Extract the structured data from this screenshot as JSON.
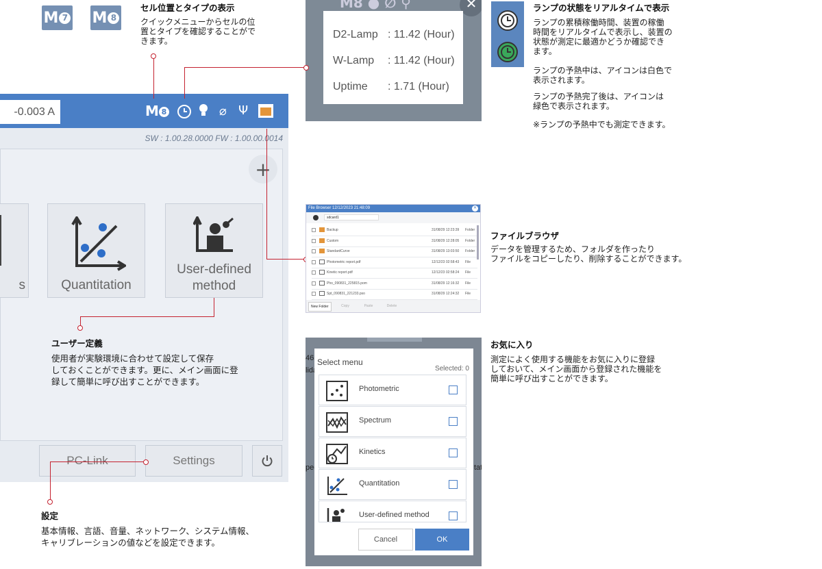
{
  "cell_section": {
    "badge7": "M7",
    "badge8": "M8",
    "title": "セル位置とタイプの表示",
    "desc": [
      "クイックメニューからセルの位",
      "置とタイプを確認することがで",
      "きます。"
    ]
  },
  "lamp_popup": {
    "rows": [
      {
        "label": "D2-Lamp",
        "value": ": 11.42 (Hour)"
      },
      {
        "label": "W-Lamp",
        "value": ": 11.42 (Hour)"
      },
      {
        "label": "Uptime",
        "value": ": 1.71 (Hour)"
      }
    ]
  },
  "lamp_section": {
    "title": "ランプの状態をリアルタイムで表示",
    "desc": [
      "ランプの累積稼働時間、装置の稼働",
      "時間をリアルタイムで表示し、装置の",
      "状態が測定に最適かどうか確認でき",
      "ます。"
    ],
    "desc2": [
      "ランプの予熱中は、アイコンは白色で",
      "表示されます。"
    ],
    "desc3": [
      "ランプの予熱完了後は、アイコンは",
      "緑色で表示されます。"
    ],
    "note": "※ランプの予熱中でも測定できます。",
    "icon_colors": {
      "warming": "#ffffff",
      "ready": "#3aa85a"
    }
  },
  "app": {
    "current_value": "-0.003 A",
    "version": "SW : 1.00.28.0000  FW : 1.00.00.0014",
    "tiles": [
      {
        "label": "s"
      },
      {
        "label": "Quantitation"
      },
      {
        "label": "User-defined method"
      }
    ],
    "buttons": {
      "pc_link": "PC-Link",
      "settings": "Settings"
    }
  },
  "user_section": {
    "title": "ユーザー定義",
    "desc": [
      "使用者が実験環境に合わせて設定して保存",
      "しておくことができます。更に、メイン画面に登",
      "録して簡単に呼び出すことができます。"
    ]
  },
  "settings_section": {
    "title": "設定",
    "desc": [
      "基本情報、言語、音量、ネットワーク、システム情報、",
      "キャリブレーションの値などを設定できます。"
    ]
  },
  "file_browser": {
    "title": "File Browser  12/12/2023 21:48:09",
    "path": "sdcard1",
    "rows": [
      {
        "name": "Backup",
        "date": "31/08/29  12:23:39",
        "type": "Folder"
      },
      {
        "name": "Custom",
        "date": "31/08/29  12:28:05",
        "type": "Folder"
      },
      {
        "name": "StandardCurve",
        "date": "31/08/29  13:03:50",
        "type": "Folder"
      },
      {
        "name": "Photometric report.pdf",
        "date": "12/12/23  02:58:43",
        "type": "File"
      },
      {
        "name": "Kinetic report.pdf",
        "date": "12/12/23  02:58:24",
        "type": "File"
      },
      {
        "name": "Pho_090831_225815.pom",
        "date": "31/08/29  12:16:32",
        "type": "File"
      },
      {
        "name": "Spt_090831_221233.pso",
        "date": "31/08/29  12:24:32",
        "type": "File"
      }
    ],
    "actions": [
      "New Folder",
      "Copy",
      "Paste",
      "Delete"
    ]
  },
  "file_section": {
    "title": "ファイルブラウザ",
    "desc": [
      "データを管理するため、フォルダを作ったり",
      "ファイルをコピーしたり、削除することができます。"
    ]
  },
  "favorites_dialog": {
    "title": "Select menu",
    "selected": "Selected: 0",
    "items": [
      "Photometric",
      "Spectrum",
      "Kinetics",
      "Quantitation",
      "User-defined method"
    ],
    "cancel": "Cancel",
    "ok": "OK",
    "bg_fragments": {
      "left1": "46",
      "left2": "lida",
      "left3": "pec",
      "right": "tat"
    }
  },
  "fav_section": {
    "title": "お気に入り",
    "desc": [
      "測定によく使用する機能をお気に入りに登録",
      "しておいて、メイン画面から登録された機能を",
      "簡単に呼び出すことができます。"
    ]
  },
  "colors": {
    "accent": "#4a7fc6",
    "callout": "#c4212f",
    "ok_button": "#4a7fc6"
  }
}
